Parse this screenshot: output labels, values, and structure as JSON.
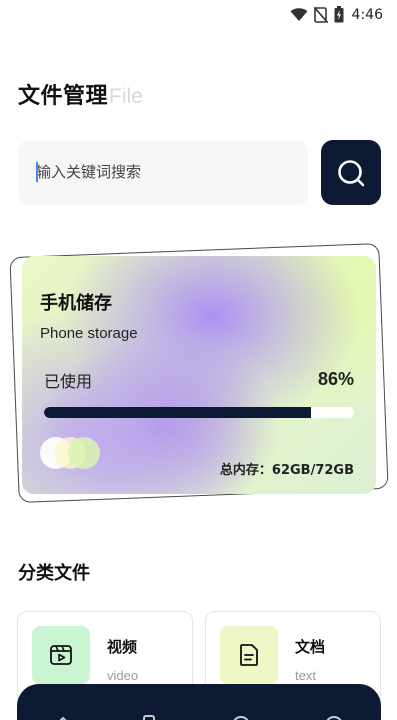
{
  "status_bar": {
    "time": "4:46",
    "icons": [
      "wifi-icon",
      "signal-off-icon",
      "battery-icon"
    ]
  },
  "header": {
    "title_cn": "文件管理",
    "title_en": "File"
  },
  "search": {
    "placeholder": "输入关键词搜索",
    "button_icon": "search-icon"
  },
  "storage": {
    "title": "手机储存",
    "subtitle": "Phone storage",
    "used_label": "已使用",
    "used_percent_text": "86%",
    "used_fraction": 0.86,
    "total_text": "总内存：62GB/72GB"
  },
  "categories": {
    "title": "分类文件",
    "items": [
      {
        "name": "视频",
        "en": "video",
        "icon": "video-icon"
      },
      {
        "name": "文档",
        "en": "text",
        "icon": "document-icon"
      }
    ]
  },
  "colors": {
    "accent_dark": "#0d1a33",
    "video_bg": "#c9f5d2",
    "doc_bg": "#eef8c6"
  },
  "bottom_nav": {
    "icons": [
      "home-icon",
      "phone-icon",
      "file-icon",
      "user-icon"
    ]
  }
}
